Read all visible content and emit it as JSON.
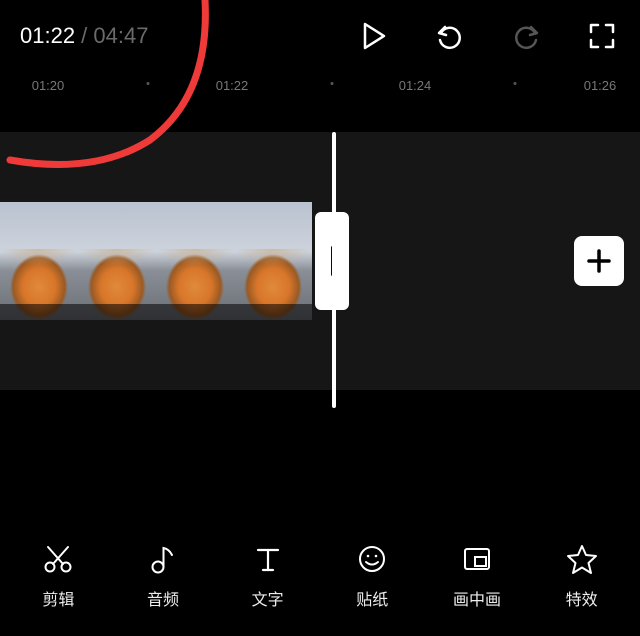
{
  "header": {
    "currentTime": "01:22",
    "separator": " / ",
    "totalTime": "04:47"
  },
  "ruler": {
    "marks": [
      "01:20",
      "01:22",
      "01:24",
      "01:26"
    ]
  },
  "timeline": {
    "addLabel": "+"
  },
  "tools": [
    {
      "id": "edit",
      "label": "剪辑"
    },
    {
      "id": "audio",
      "label": "音频"
    },
    {
      "id": "text",
      "label": "文字"
    },
    {
      "id": "sticker",
      "label": "贴纸"
    },
    {
      "id": "pip",
      "label": "画中画"
    },
    {
      "id": "effects",
      "label": "特效"
    }
  ]
}
